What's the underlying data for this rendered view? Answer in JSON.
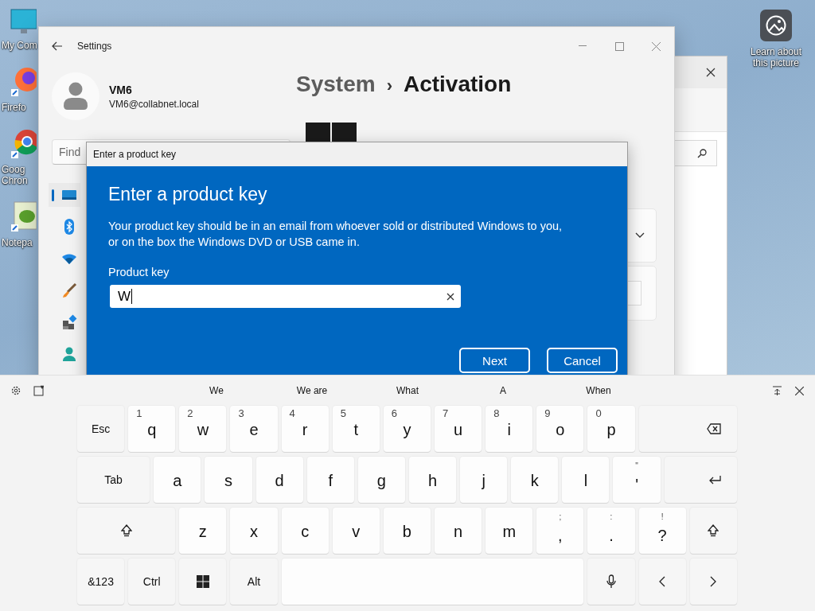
{
  "desktop_icons": [
    {
      "kind": "monitor",
      "label": "My Com"
    },
    {
      "kind": "firefox",
      "label": "Firefo"
    },
    {
      "kind": "chrome",
      "label": "Goog Chron"
    },
    {
      "kind": "notepad",
      "label": "Notepa"
    }
  ],
  "spotlight": {
    "label": "Learn about this picture"
  },
  "settings": {
    "title": "Settings",
    "user": {
      "name": "VM6",
      "email": "VM6@collabnet.local"
    },
    "breadcrumb": {
      "parent": "System",
      "separator": "›",
      "current": "Activation"
    },
    "search": {
      "placeholder": "Find"
    },
    "nav": [
      {
        "kind": "system",
        "selected": true
      },
      {
        "kind": "bluetooth",
        "selected": false
      },
      {
        "kind": "network",
        "selected": false
      },
      {
        "kind": "brush",
        "selected": false
      },
      {
        "kind": "apps",
        "selected": false
      },
      {
        "kind": "account",
        "selected": false
      }
    ]
  },
  "dialog": {
    "title": "Enter a product key",
    "heading": "Enter a product key",
    "description": "Your product key should be in an email from whoever sold or distributed Windows to you, or on the box the Windows DVD or USB came in.",
    "field": {
      "label": "Product key",
      "value": "W"
    },
    "buttons": [
      "Next",
      "Cancel"
    ]
  },
  "keyboard": {
    "suggestions": [
      "We",
      "We are",
      "What",
      "A",
      "When"
    ],
    "rows": [
      {
        "keys": [
          {
            "kind": "text",
            "label": "Esc"
          },
          {
            "kind": "letter",
            "label": "q",
            "hint": "1"
          },
          {
            "kind": "letter",
            "label": "w",
            "hint": "2"
          },
          {
            "kind": "letter",
            "label": "e",
            "hint": "3"
          },
          {
            "kind": "letter",
            "label": "r",
            "hint": "4"
          },
          {
            "kind": "letter",
            "label": "t",
            "hint": "5"
          },
          {
            "kind": "letter",
            "label": "y",
            "hint": "6"
          },
          {
            "kind": "letter",
            "label": "u",
            "hint": "7"
          },
          {
            "kind": "letter",
            "label": "i",
            "hint": "8"
          },
          {
            "kind": "letter",
            "label": "o",
            "hint": "9"
          },
          {
            "kind": "letter",
            "label": "p",
            "hint": "0"
          },
          {
            "kind": "backspace"
          }
        ]
      },
      {
        "keys": [
          {
            "kind": "text",
            "label": "Tab"
          },
          {
            "kind": "letter",
            "label": "a"
          },
          {
            "kind": "letter",
            "label": "s"
          },
          {
            "kind": "letter",
            "label": "d"
          },
          {
            "kind": "letter",
            "label": "f"
          },
          {
            "kind": "letter",
            "label": "g"
          },
          {
            "kind": "letter",
            "label": "h"
          },
          {
            "kind": "letter",
            "label": "j"
          },
          {
            "kind": "letter",
            "label": "k"
          },
          {
            "kind": "letter",
            "label": "l"
          },
          {
            "kind": "symbol",
            "label": "'",
            "hint": "\""
          },
          {
            "kind": "enter"
          }
        ]
      },
      {
        "keys": [
          {
            "kind": "shift"
          },
          {
            "kind": "letter",
            "label": "z"
          },
          {
            "kind": "letter",
            "label": "x"
          },
          {
            "kind": "letter",
            "label": "c"
          },
          {
            "kind": "letter",
            "label": "v"
          },
          {
            "kind": "letter",
            "label": "b"
          },
          {
            "kind": "letter",
            "label": "n"
          },
          {
            "kind": "letter",
            "label": "m"
          },
          {
            "kind": "symbol",
            "label": ",",
            "hint": ";"
          },
          {
            "kind": "symbol",
            "label": ".",
            "hint": ":"
          },
          {
            "kind": "symbol",
            "label": "?",
            "hint": "!"
          },
          {
            "kind": "shift"
          }
        ]
      },
      {
        "keys": [
          {
            "kind": "text",
            "label": "&123"
          },
          {
            "kind": "text",
            "label": "Ctrl"
          },
          {
            "kind": "windows"
          },
          {
            "kind": "text",
            "label": "Alt"
          },
          {
            "kind": "space"
          },
          {
            "kind": "mic"
          },
          {
            "kind": "left"
          },
          {
            "kind": "right"
          }
        ]
      }
    ]
  }
}
